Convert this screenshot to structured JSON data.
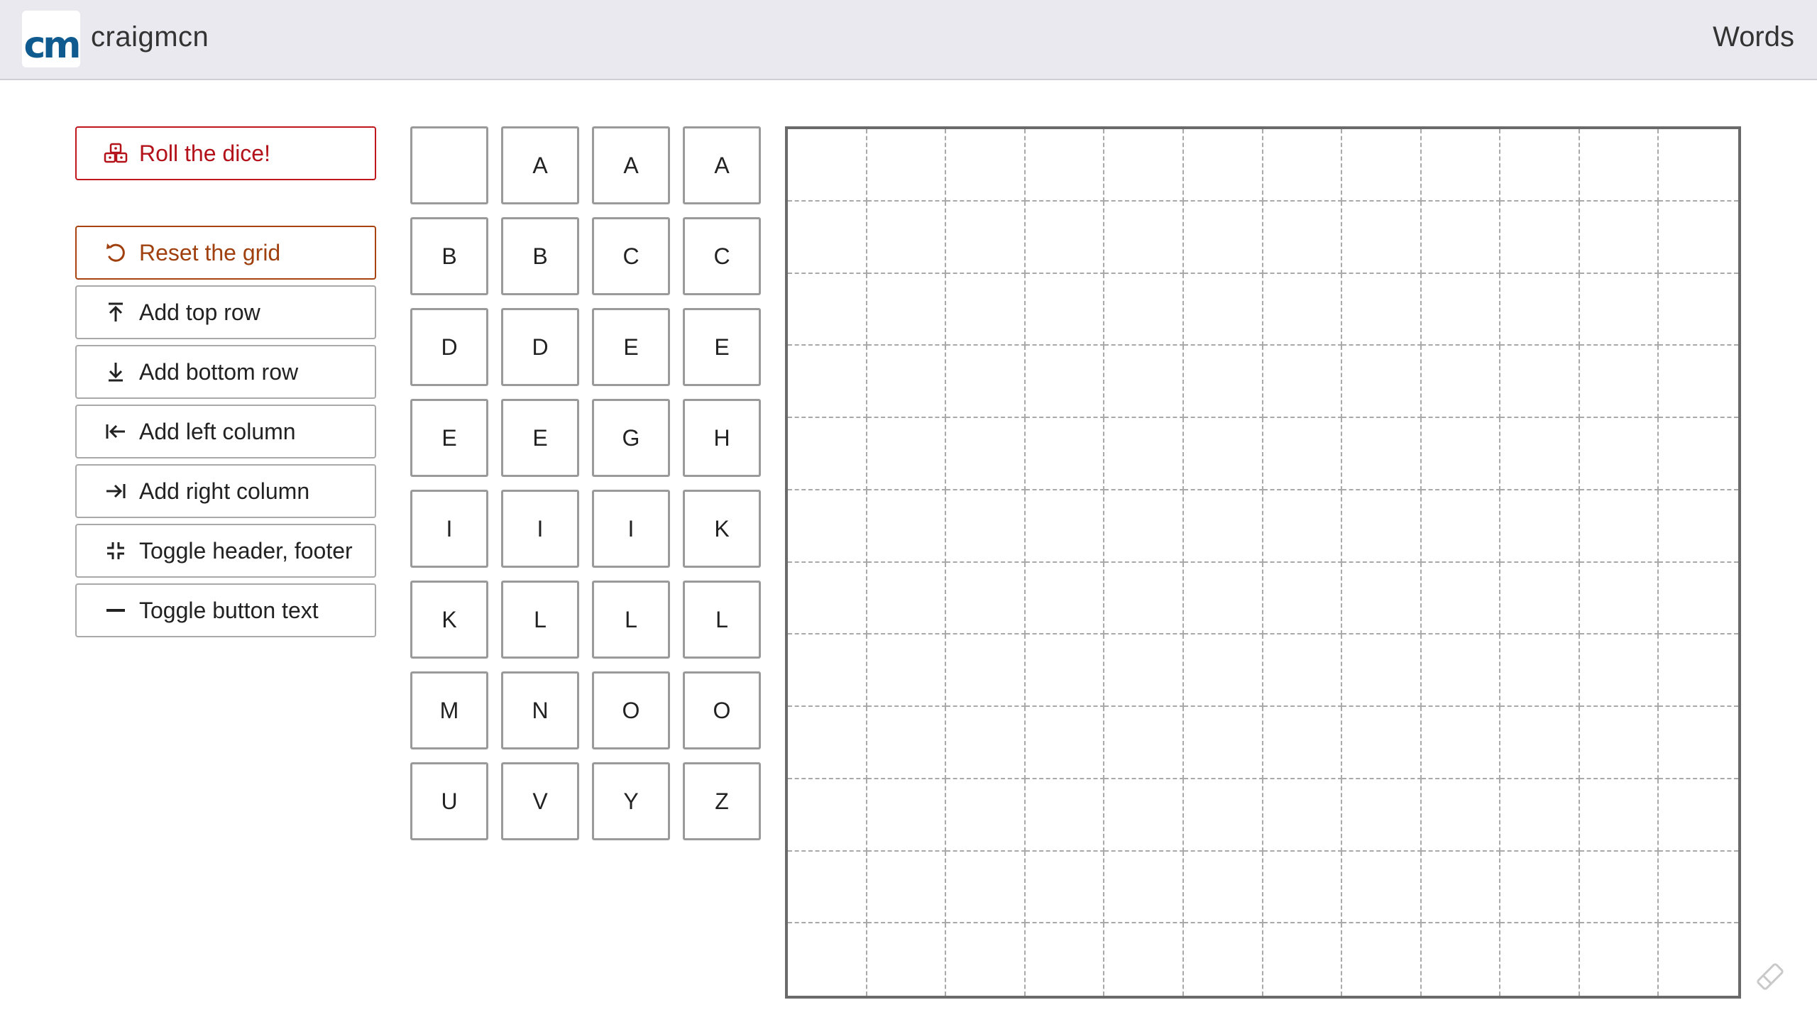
{
  "header": {
    "logo_text": "cm",
    "brand": "craigmcn",
    "title": "Words"
  },
  "colors": {
    "header_bg": "#e9e9ef",
    "roll_accent": "#b3121a",
    "reset_accent": "#a0400f",
    "logo_blue": "#0f5a8e"
  },
  "controls": {
    "roll": {
      "label": "Roll the dice!",
      "icon": "dice-icon"
    },
    "reset": {
      "label": "Reset the grid",
      "icon": "undo-icon"
    },
    "add_top": {
      "label": "Add top row",
      "icon": "arrow-up-to-line-icon"
    },
    "add_bottom": {
      "label": "Add bottom row",
      "icon": "arrow-down-to-line-icon"
    },
    "add_left": {
      "label": "Add left column",
      "icon": "arrow-left-to-line-icon"
    },
    "add_right": {
      "label": "Add right column",
      "icon": "arrow-right-to-line-icon"
    },
    "toggle_header": {
      "label": "Toggle header, footer",
      "icon": "compress-icon"
    },
    "toggle_text": {
      "label": "Toggle button text",
      "icon": "minus-icon"
    }
  },
  "tiles": [
    "",
    "A",
    "A",
    "A",
    "B",
    "B",
    "C",
    "C",
    "D",
    "D",
    "E",
    "E",
    "E",
    "E",
    "G",
    "H",
    "I",
    "I",
    "I",
    "K",
    "K",
    "L",
    "L",
    "L",
    "M",
    "N",
    "O",
    "O",
    "U",
    "V",
    "Y",
    "Z"
  ],
  "board": {
    "rows": 12,
    "cols": 12
  },
  "corner_icon": "pencil-eraser-icon"
}
